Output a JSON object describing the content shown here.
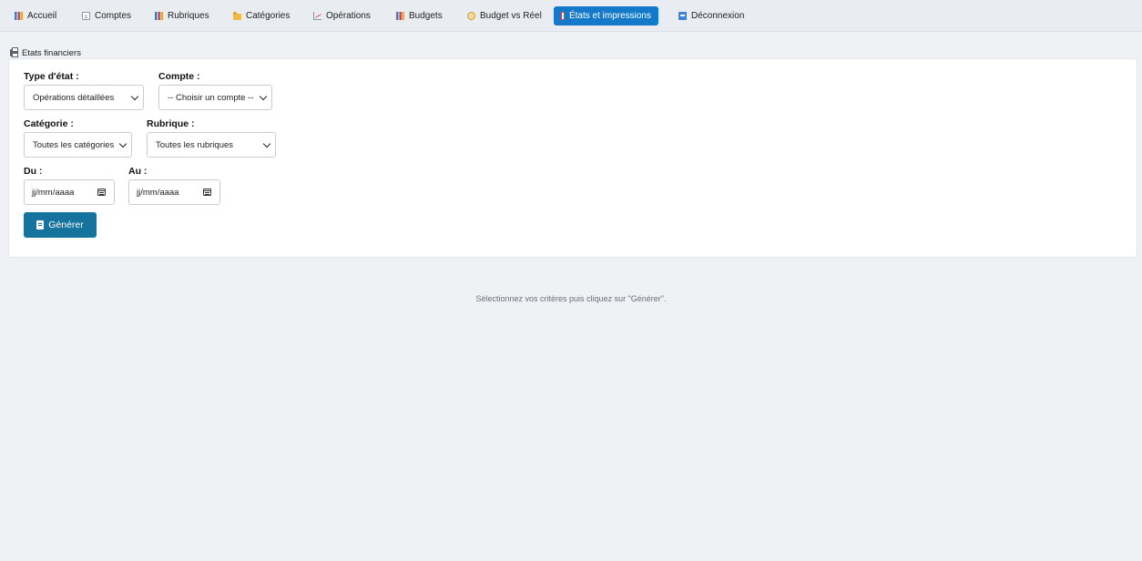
{
  "nav": {
    "items": [
      {
        "label": "Accueil",
        "icon": "bar-chart-icon"
      },
      {
        "label": "Comptes",
        "icon": "document-icon"
      },
      {
        "label": "Rubriques",
        "icon": "bar-chart-icon"
      },
      {
        "label": "Catégories",
        "icon": "folder-icon"
      },
      {
        "label": "Opérations",
        "icon": "line-chart-icon"
      },
      {
        "label": "Budgets",
        "icon": "bar-chart-icon"
      },
      {
        "label": "Budget vs Réel",
        "icon": "balance-icon"
      },
      {
        "label": "États et impressions",
        "icon": "print-icon",
        "active": true
      },
      {
        "label": "Déconnexion",
        "icon": "arrow-right-icon"
      }
    ],
    "active_color": "#1479c9"
  },
  "section": {
    "title": "Etats financiers",
    "icon": "printer-icon"
  },
  "form": {
    "type_label": "Type d'état :",
    "type_value": "Opérations détaillées",
    "compte_label": "Compte :",
    "compte_value": "-- Choisir un compte --",
    "categorie_label": "Catégorie :",
    "categorie_value": "Toutes les catégories",
    "rubrique_label": "Rubrique :",
    "rubrique_value": "Toutes les rubriques",
    "du_label": "Du :",
    "du_placeholder": "jj/mm/aaaa",
    "au_label": "Au :",
    "au_placeholder": "jj/mm/aaaa",
    "generate_label": "Générer",
    "button_color": "#16739e"
  },
  "hint": "Sélectionnez vos critères puis cliquez sur \"Générer\"."
}
